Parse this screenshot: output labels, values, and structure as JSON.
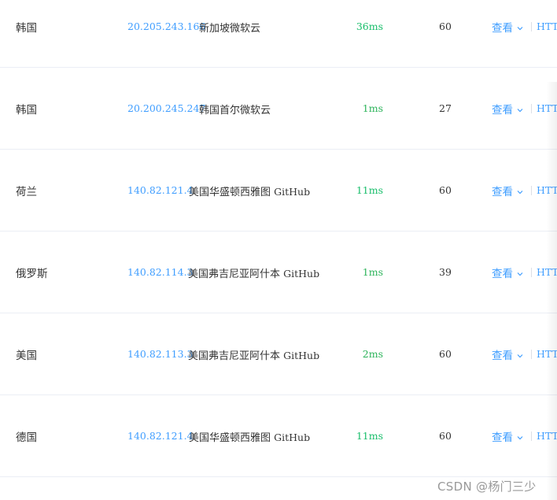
{
  "colors": {
    "link": "#409eff",
    "latency_fast": "#19be6b",
    "latency_normal": "#2db45b",
    "text": "#333333",
    "border": "#ebeef5"
  },
  "rows": [
    {
      "region": "韩国",
      "ip": "20.205.243.166",
      "location": "新加坡微软云",
      "location_latin": "",
      "latency": "36ms",
      "ttl": "60",
      "action": "查看",
      "protocol": "HTT"
    },
    {
      "region": "韩国",
      "ip": "20.200.245.247",
      "location": "韩国首尔微软云",
      "location_latin": "",
      "latency": "1ms",
      "ttl": "27",
      "action": "查看",
      "protocol": "HTT"
    },
    {
      "region": "荷兰",
      "ip": "140.82.121.4",
      "location": "美国华盛顿西雅图 ",
      "location_latin": "GitHub",
      "latency": "11ms",
      "ttl": "60",
      "action": "查看",
      "protocol": "HTT"
    },
    {
      "region": "俄罗斯",
      "ip": "140.82.114.3",
      "location": "美国弗吉尼亚阿什本 ",
      "location_latin": "GitHub",
      "latency": "1ms",
      "ttl": "39",
      "action": "查看",
      "protocol": "HTT"
    },
    {
      "region": "美国",
      "ip": "140.82.113.3",
      "location": "美国弗吉尼亚阿什本 ",
      "location_latin": "GitHub",
      "latency": "2ms",
      "ttl": "60",
      "action": "查看",
      "protocol": "HTT"
    },
    {
      "region": "德国",
      "ip": "140.82.121.4",
      "location": "美国华盛顿西雅图 ",
      "location_latin": "GitHub",
      "latency": "11ms",
      "ttl": "60",
      "action": "查看",
      "protocol": "HTT"
    }
  ],
  "watermark": "CSDN @杨门三少",
  "icons": {
    "dropdown": "chevron-down-icon"
  }
}
